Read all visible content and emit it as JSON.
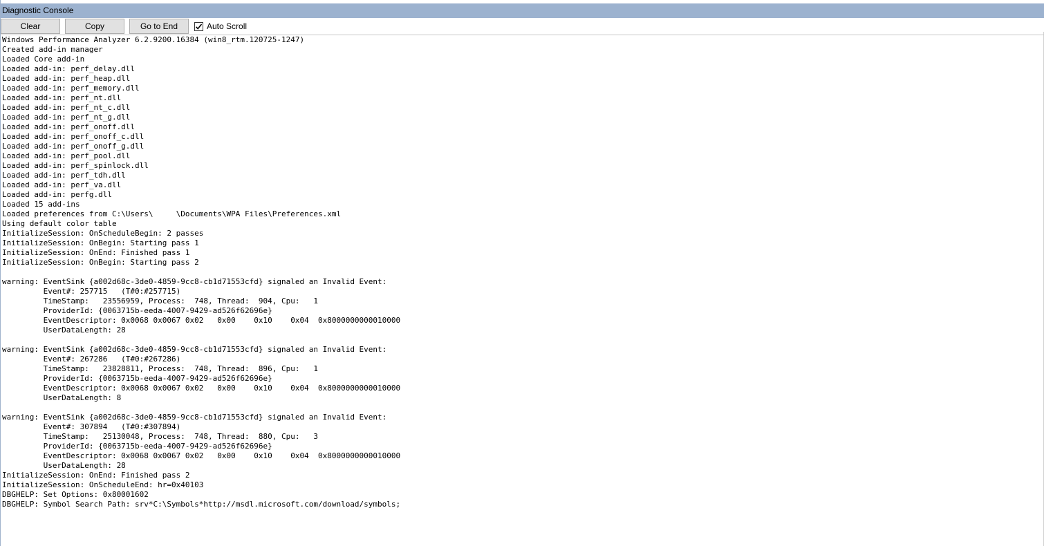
{
  "window": {
    "title": "Diagnostic Console"
  },
  "toolbar": {
    "clear_label": "Clear",
    "copy_label": "Copy",
    "go_to_end_label": "Go to End",
    "auto_scroll_label": "Auto Scroll",
    "auto_scroll_checked": true
  },
  "log": {
    "lines": [
      "Windows Performance Analyzer 6.2.9200.16384 (win8_rtm.120725-1247)",
      "Created add-in manager",
      "Loaded Core add-in",
      "Loaded add-in: perf_delay.dll",
      "Loaded add-in: perf_heap.dll",
      "Loaded add-in: perf_memory.dll",
      "Loaded add-in: perf_nt.dll",
      "Loaded add-in: perf_nt_c.dll",
      "Loaded add-in: perf_nt_g.dll",
      "Loaded add-in: perf_onoff.dll",
      "Loaded add-in: perf_onoff_c.dll",
      "Loaded add-in: perf_onoff_g.dll",
      "Loaded add-in: perf_pool.dll",
      "Loaded add-in: perf_spinlock.dll",
      "Loaded add-in: perf_tdh.dll",
      "Loaded add-in: perf_va.dll",
      "Loaded add-in: perfg.dll",
      "Loaded 15 add-ins",
      "Loaded preferences from C:\\Users\\     \\Documents\\WPA Files\\Preferences.xml",
      "Using default color table",
      "InitializeSession: OnScheduleBegin: 2 passes",
      "InitializeSession: OnBegin: Starting pass 1",
      "InitializeSession: OnEnd: Finished pass 1",
      "InitializeSession: OnBegin: Starting pass 2",
      "",
      "warning: EventSink {a002d68c-3de0-4859-9cc8-cb1d71553cfd} signaled an Invalid Event:",
      "         Event#: 257715   (T#0:#257715)",
      "         TimeStamp:   23556959, Process:  748, Thread:  904, Cpu:   1",
      "         ProviderId: {0063715b-eeda-4007-9429-ad526f62696e}",
      "         EventDescriptor: 0x0068 0x0067 0x02   0x00    0x10    0x04  0x8000000000010000",
      "         UserDataLength: 28",
      "",
      "warning: EventSink {a002d68c-3de0-4859-9cc8-cb1d71553cfd} signaled an Invalid Event:",
      "         Event#: 267286   (T#0:#267286)",
      "         TimeStamp:   23828811, Process:  748, Thread:  896, Cpu:   1",
      "         ProviderId: {0063715b-eeda-4007-9429-ad526f62696e}",
      "         EventDescriptor: 0x0068 0x0067 0x02   0x00    0x10    0x04  0x8000000000010000",
      "         UserDataLength: 8",
      "",
      "warning: EventSink {a002d68c-3de0-4859-9cc8-cb1d71553cfd} signaled an Invalid Event:",
      "         Event#: 307894   (T#0:#307894)",
      "         TimeStamp:   25130048, Process:  748, Thread:  880, Cpu:   3",
      "         ProviderId: {0063715b-eeda-4007-9429-ad526f62696e}",
      "         EventDescriptor: 0x0068 0x0067 0x02   0x00    0x10    0x04  0x8000000000010000",
      "         UserDataLength: 28",
      "InitializeSession: OnEnd: Finished pass 2",
      "InitializeSession: OnScheduleEnd: hr=0x40103",
      "DBGHELP: Set Options: 0x80001602",
      "DBGHELP: Symbol Search Path: srv*C:\\Symbols*http://msdl.microsoft.com/download/symbols;"
    ]
  },
  "colors": {
    "titlebar_bg": "#9cb2cf",
    "button_bg": "#e1e1e1",
    "button_border": "#adadad"
  }
}
